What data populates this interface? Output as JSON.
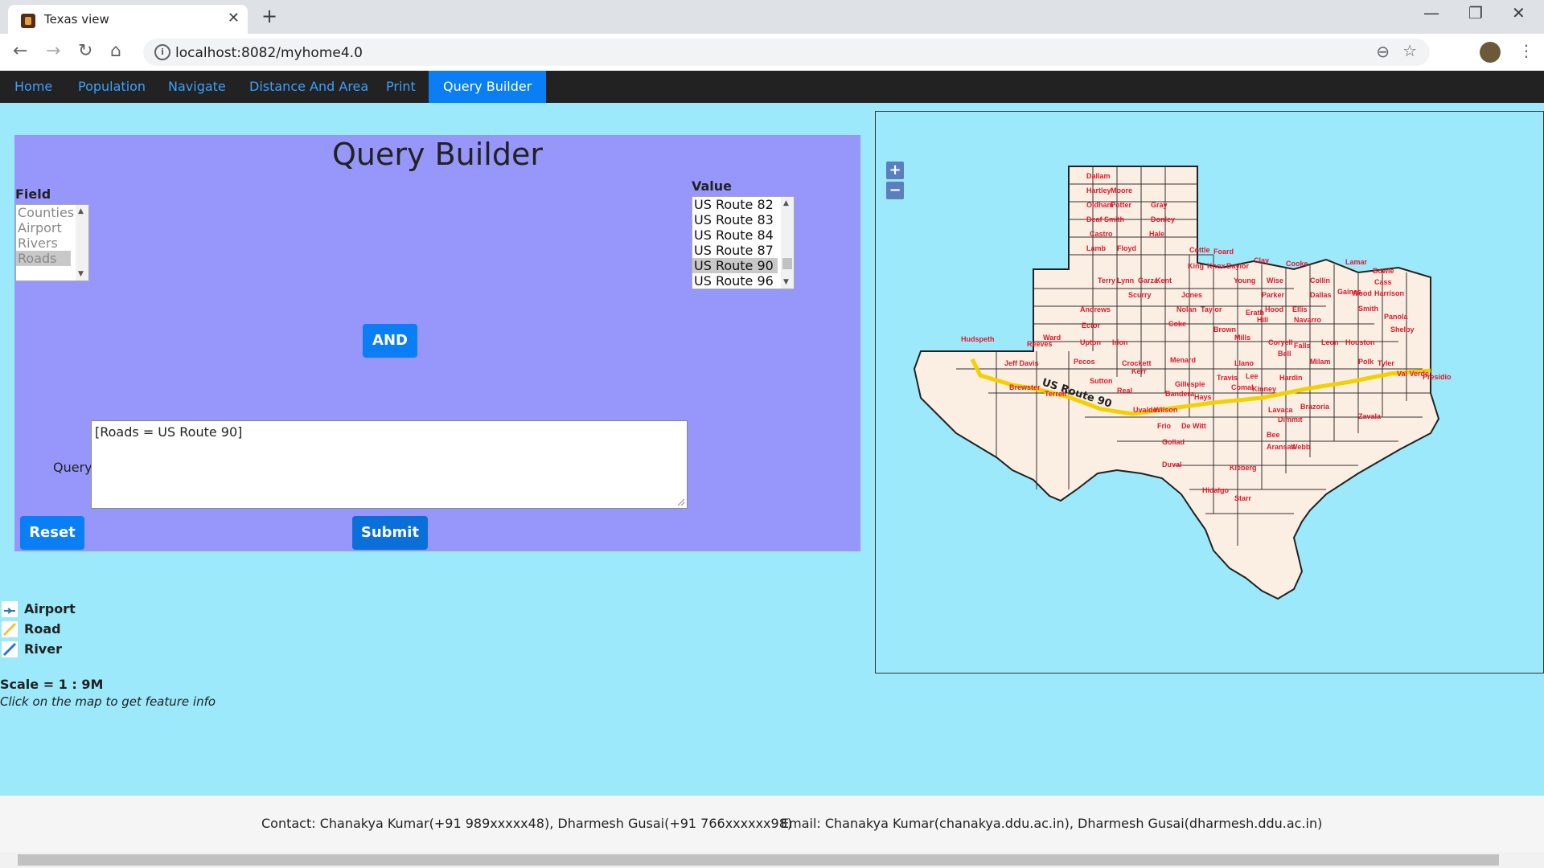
{
  "browser": {
    "tab_title": "Texas view",
    "url": "localhost:8082/myhome4.0",
    "new_tab_icon": "plus-icon",
    "tab_close_icon": "close-icon"
  },
  "nav": {
    "items": [
      "Home",
      "Population",
      "Navigate",
      "Distance And Area",
      "Print",
      "Query Builder"
    ],
    "active": "Query Builder"
  },
  "query_builder": {
    "title": "Query Builder",
    "field_label": "Field",
    "field_options": [
      "Counties",
      "Airport",
      "Rivers",
      "Roads"
    ],
    "field_selected": "Roads",
    "value_label": "Value",
    "value_options": [
      "US Route 82",
      "US Route 83",
      "US Route 84",
      "US Route 87",
      "US Route 90",
      "US Route 96"
    ],
    "value_selected": "US Route 90",
    "and_button": "AND",
    "query_label": "Query",
    "query_text": "[Roads = US Route 90]",
    "reset_button": "Reset",
    "submit_button": "Submit"
  },
  "legend": {
    "items": [
      {
        "label": "Airport",
        "icon": "airport-icon"
      },
      {
        "label": "Road",
        "icon": "road-icon"
      },
      {
        "label": "River",
        "icon": "river-icon"
      }
    ]
  },
  "scale_text": "Scale = 1 : 9M",
  "hint_text": "Click on the map to get feature info",
  "map": {
    "zoom_in": "+",
    "zoom_out": "−",
    "road_label": "US Route 90",
    "county_labels": [
      "Dallam",
      "Hartley",
      "Moore",
      "Oldham",
      "Potter",
      "Gray",
      "Deaf Smith",
      "Donley",
      "Castro",
      "Hale",
      "Lamb",
      "Floyd",
      "Cottle",
      "Foard",
      "King",
      "Knox",
      "Baylor",
      "Clay",
      "Cooke",
      "Lamar",
      "Bowie",
      "Terry",
      "Lynn",
      "Garza",
      "Kent",
      "Young",
      "Wise",
      "Collin",
      "Cass",
      "Gaines",
      "Scurry",
      "Jones",
      "Parker",
      "Dallas",
      "Wood",
      "Harrison",
      "Andrews",
      "Nolan",
      "Taylor",
      "Erath",
      "Hood",
      "Ellis",
      "Smith",
      "Panola",
      "Ector",
      "Coke",
      "Brown",
      "Hill",
      "Navarro",
      "Shelby",
      "Hudspeth",
      "Reeves",
      "Ward",
      "Upton",
      "Irion",
      "Mills",
      "Coryell",
      "Falls",
      "Leon",
      "Houston",
      "Jeff Davis",
      "Pecos",
      "Crockett",
      "Menard",
      "Llano",
      "Bell",
      "Milam",
      "Polk",
      "Tyler",
      "Presidio",
      "Brewster",
      "Terrell",
      "Sutton",
      "Kerr",
      "Gillespie",
      "Travis",
      "Lee",
      "Hardin",
      "Val Verde",
      "Real",
      "Bandera",
      "Hays",
      "Comal",
      "Kinney",
      "Uvalde",
      "Wilson",
      "Lavaca",
      "Brazoria",
      "Zavala",
      "Frio",
      "De Witt",
      "Dimmit",
      "Goliad",
      "Bee",
      "Aransas",
      "Webb",
      "Duval",
      "Kleberg",
      "Starr",
      "Hidalgo"
    ]
  },
  "footer": {
    "contact": "Contact: Chanakya Kumar(+91 989xxxxx48), Dharmesh Gusai(+91 766xxxxxx98)",
    "email": "Email: Chanakya Kumar(chanakya.ddu.ac.in), Dharmesh Gusai(dharmesh.ddu.ac.in)"
  }
}
